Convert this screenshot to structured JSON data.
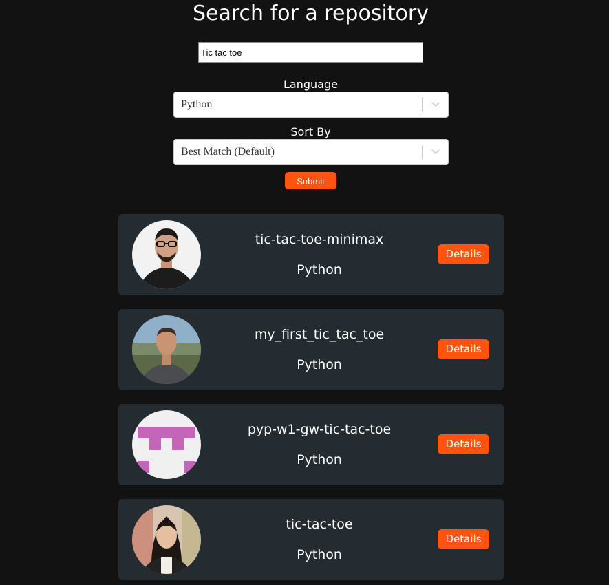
{
  "header": {
    "title": "Search for a repository"
  },
  "search": {
    "value": "Tic tac toe"
  },
  "language": {
    "label": "Language",
    "selected": "Python"
  },
  "sort": {
    "label": "Sort By",
    "selected": "Best Match (Default)"
  },
  "submit_label": "Submit",
  "results": [
    {
      "name": "tic-tac-toe-minimax",
      "language": "Python",
      "details_label": "Details"
    },
    {
      "name": "my_first_tic_tac_toe",
      "language": "Python",
      "details_label": "Details"
    },
    {
      "name": "pyp-w1-gw-tic-tac-toe",
      "language": "Python",
      "details_label": "Details"
    },
    {
      "name": "tic-tac-toe",
      "language": "Python",
      "details_label": "Details"
    }
  ],
  "colors": {
    "background": "#121212",
    "card": "#242b31",
    "accent": "#ff5310"
  }
}
